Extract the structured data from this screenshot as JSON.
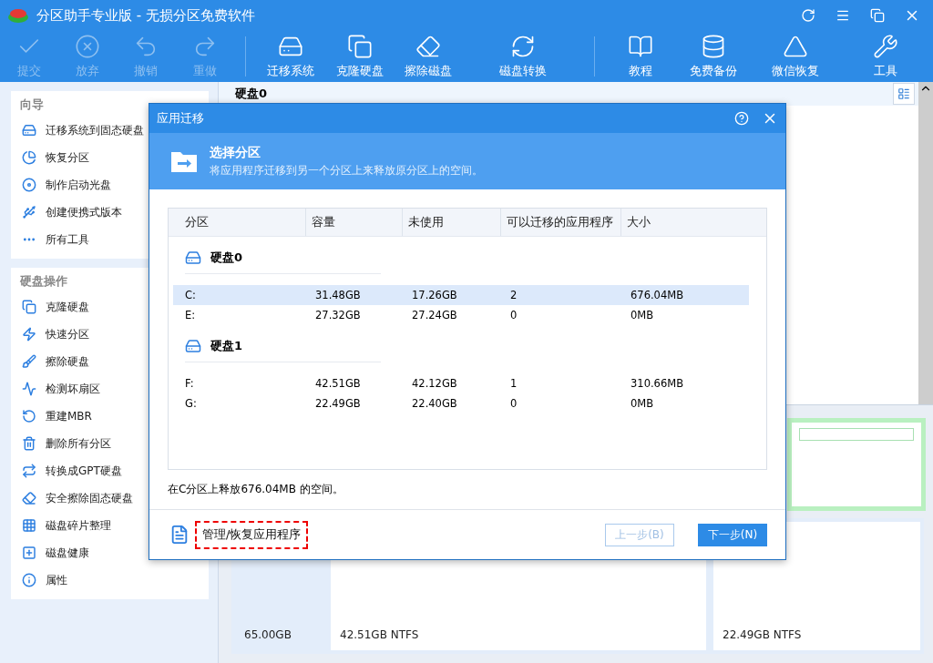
{
  "window": {
    "title": "分区助手专业版 - 无损分区免费软件"
  },
  "toolbar": [
    {
      "label": "提交",
      "kind": "check",
      "disabled": true
    },
    {
      "label": "放弃",
      "kind": "cancel",
      "disabled": true
    },
    {
      "label": "撤销",
      "kind": "undo",
      "disabled": true
    },
    {
      "label": "重做",
      "kind": "redo",
      "disabled": true
    },
    {
      "label": "迁移系统",
      "kind": "migrate",
      "disabled": false,
      "separator_before": true
    },
    {
      "label": "克隆硬盘",
      "kind": "clone",
      "disabled": false
    },
    {
      "label": "擦除磁盘",
      "kind": "wipe",
      "disabled": false
    },
    {
      "label": "磁盘转换",
      "kind": "convert",
      "disabled": false
    },
    {
      "label": "教程",
      "kind": "book",
      "disabled": false,
      "separator_before": true
    },
    {
      "label": "免费备份",
      "kind": "backup",
      "disabled": false
    },
    {
      "label": "微信恢复",
      "kind": "recover",
      "disabled": false
    },
    {
      "label": "工具",
      "kind": "tools",
      "disabled": false
    }
  ],
  "sidebar": [
    {
      "title": "向导",
      "items": [
        {
          "label": "迁移系统到固态硬盘",
          "kind": "drive"
        },
        {
          "label": "恢复分区",
          "kind": "pie"
        },
        {
          "label": "制作启动光盘",
          "kind": "disc"
        },
        {
          "label": "创建便携式版本",
          "kind": "usb"
        },
        {
          "label": "所有工具",
          "kind": "more"
        }
      ]
    },
    {
      "title": "硬盘操作",
      "items": [
        {
          "label": "克隆硬盘",
          "kind": "clone"
        },
        {
          "label": "快速分区",
          "kind": "bolt"
        },
        {
          "label": "擦除硬盘",
          "kind": "broom"
        },
        {
          "label": "检测坏扇区",
          "kind": "scan"
        },
        {
          "label": "重建MBR",
          "kind": "rebuild"
        },
        {
          "label": "删除所有分区",
          "kind": "trash"
        },
        {
          "label": "转换成GPT硬盘",
          "kind": "convert"
        },
        {
          "label": "安全擦除固态硬盘",
          "kind": "eraser"
        },
        {
          "label": "磁盘碎片整理",
          "kind": "defrag"
        },
        {
          "label": "磁盘健康",
          "kind": "health"
        },
        {
          "label": "属性",
          "kind": "info"
        }
      ]
    }
  ],
  "main": {
    "disk_header": "硬盘0",
    "cards": [
      {
        "text": "65.00GB"
      },
      {
        "text": "42.51GB NTFS"
      },
      {
        "text": "22.49GB NTFS"
      }
    ]
  },
  "dialog": {
    "title": "应用迁移",
    "heading": "选择分区",
    "subheading": "将应用程序迁移到另一个分区上来释放原分区上的空间。",
    "columns": [
      "分区",
      "容量",
      "未使用",
      "可以迁移的应用程序",
      "大小"
    ],
    "disks": [
      {
        "name": "硬盘0",
        "rows": [
          {
            "cells": [
              "C:",
              "31.48GB",
              "17.26GB",
              "2",
              "676.04MB"
            ],
            "selected": true
          },
          {
            "cells": [
              "E:",
              "27.32GB",
              "27.24GB",
              "0",
              "0MB"
            ],
            "selected": false
          }
        ]
      },
      {
        "name": "硬盘1",
        "rows": [
          {
            "cells": [
              "F:",
              "42.51GB",
              "42.12GB",
              "1",
              "310.66MB"
            ],
            "selected": false
          },
          {
            "cells": [
              "G:",
              "22.49GB",
              "22.40GB",
              "0",
              "0MB"
            ],
            "selected": false
          }
        ]
      }
    ],
    "summary": "在C分区上释放676.04MB 的空间。",
    "manage_link": "管理/恢复应用程序",
    "buttons": [
      {
        "label": "上一步(B)",
        "disabled": true
      },
      {
        "label": "下一步(N)",
        "disabled": false
      }
    ]
  }
}
